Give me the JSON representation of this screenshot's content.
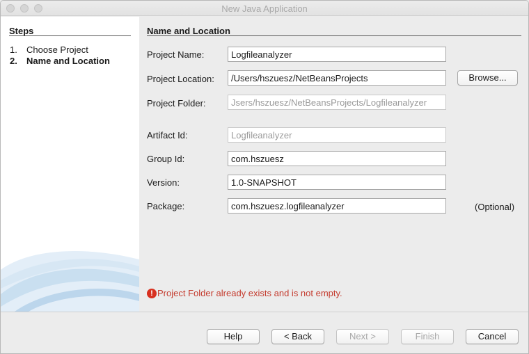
{
  "window": {
    "title": "New Java Application"
  },
  "steps": {
    "heading": "Steps",
    "items": [
      {
        "num": "1.",
        "label": "Choose Project"
      },
      {
        "num": "2.",
        "label": "Name and Location"
      }
    ]
  },
  "form": {
    "title": "Name and Location",
    "project_name": {
      "label": "Project Name:",
      "value": "Logfileanalyzer"
    },
    "project_location": {
      "label": "Project Location:",
      "value": "/Users/hszuesz/NetBeansProjects",
      "browse": "Browse..."
    },
    "project_folder": {
      "label": "Project Folder:",
      "value": "Jsers/hszuesz/NetBeansProjects/Logfileanalyzer"
    },
    "artifact_id": {
      "label": "Artifact Id:",
      "value": "Logfileanalyzer"
    },
    "group_id": {
      "label": "Group Id:",
      "value": "com.hszuesz"
    },
    "version": {
      "label": "Version:",
      "value": "1.0-SNAPSHOT"
    },
    "package": {
      "label": "Package:",
      "value": "com.hszuesz.logfileanalyzer",
      "optional": "(Optional)"
    }
  },
  "error": {
    "icon": "error-icon",
    "message": "Project Folder already exists and is not empty."
  },
  "buttons": {
    "help": "Help",
    "back": "< Back",
    "next": "Next >",
    "finish": "Finish",
    "cancel": "Cancel"
  },
  "colors": {
    "error": "#c43b2e",
    "swoosh": "#c9dff0"
  }
}
